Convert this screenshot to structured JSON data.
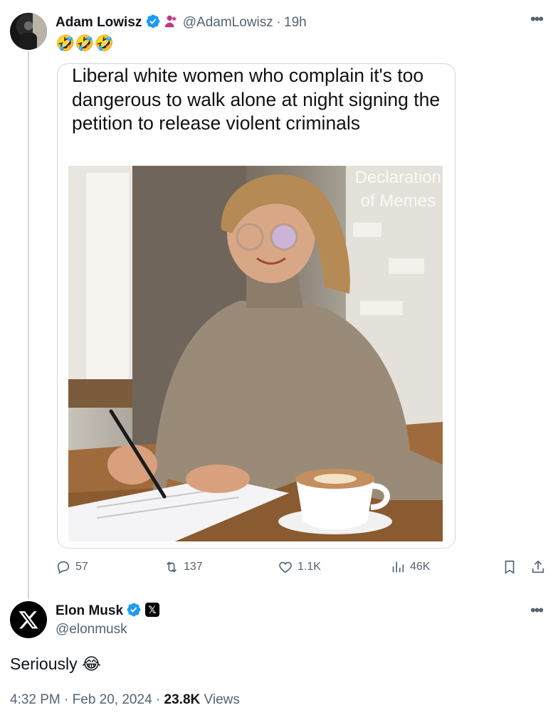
{
  "original_tweet": {
    "author_name": "Adam Lowisz",
    "handle": "@AdamLowisz",
    "separator": "·",
    "time": "19h",
    "text": "🤣🤣🤣",
    "meme": {
      "caption": "Liberal white women who complain it's too dangerous to walk alone at night signing the petition to release violent criminals",
      "watermark_line1": "Declaration",
      "watermark_line2": "of Memes"
    },
    "actions": {
      "replies": "57",
      "reposts": "137",
      "likes": "1.1K",
      "views": "46K"
    }
  },
  "reply_tweet": {
    "author_name": "Elon Musk",
    "handle": "@elonmusk",
    "text": "Seriously 😂",
    "time": "4:32 PM",
    "date": "Feb 20, 2024",
    "views_count": "23.8K",
    "views_label": "Views",
    "dot": "·"
  },
  "icons": {
    "more": "more-icon",
    "verified": "verified-badge-icon"
  },
  "colors": {
    "verified_blue": "#1d9bf0",
    "muted_text": "#536471",
    "affiliate_pink": "#c13584"
  }
}
